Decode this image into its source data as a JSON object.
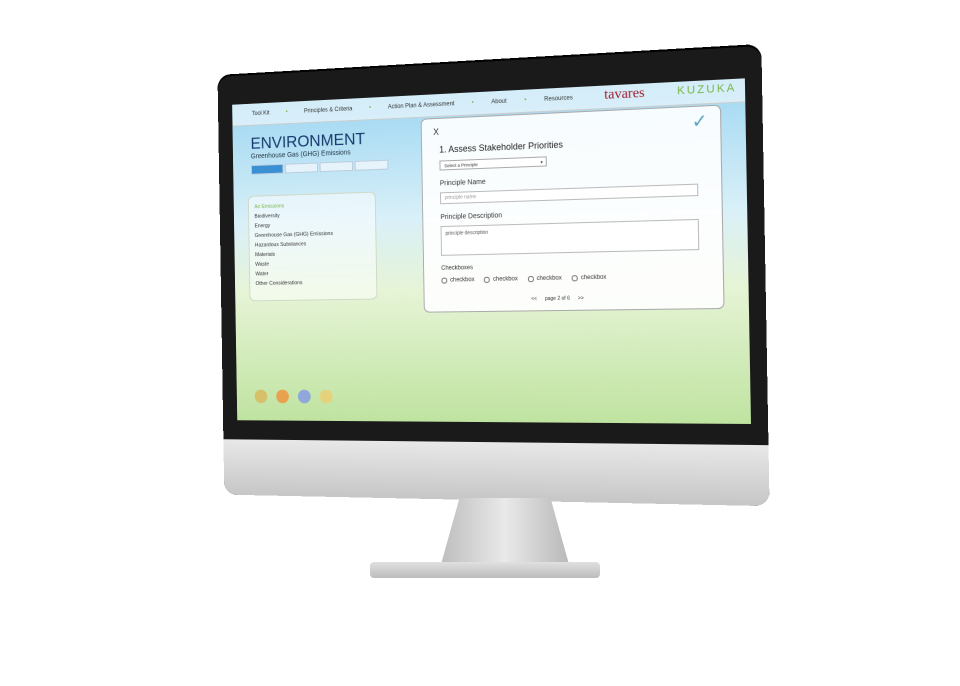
{
  "nav": [
    "Tool Kit",
    "Principles & Criteria",
    "Action Plan & Assessment",
    "About",
    "Resources"
  ],
  "brand": {
    "primary": "tavares",
    "secondary": "KUZUKA"
  },
  "page": {
    "title": "ENVIRONMENT",
    "subtitle": "Greenhouse Gas (GHG) Emissions"
  },
  "sidebar": [
    "Air Emissions",
    "Biodiversity",
    "Energy",
    "Greenhouse Gas (GHG) Emissions",
    "Hazardous Substances",
    "Materials",
    "Waste",
    "Water",
    "Other Considerations"
  ],
  "modal": {
    "close": "X",
    "title": "1. Assess Stakeholder Priorities",
    "select": "Select a Principle",
    "name_label": "Principle Name",
    "name_placeholder": "principle name",
    "desc_label": "Principle Description",
    "desc_value": "principle description",
    "checkbox_label": "Checkboxes",
    "checkbox_item": "checkbox",
    "pager_prev": "<<",
    "pager_text": "page 2 of 6",
    "pager_next": ">>"
  },
  "colors": {
    "accent": "#7ab648",
    "brand_red": "#a11d2b",
    "title_blue": "#163a6b"
  }
}
